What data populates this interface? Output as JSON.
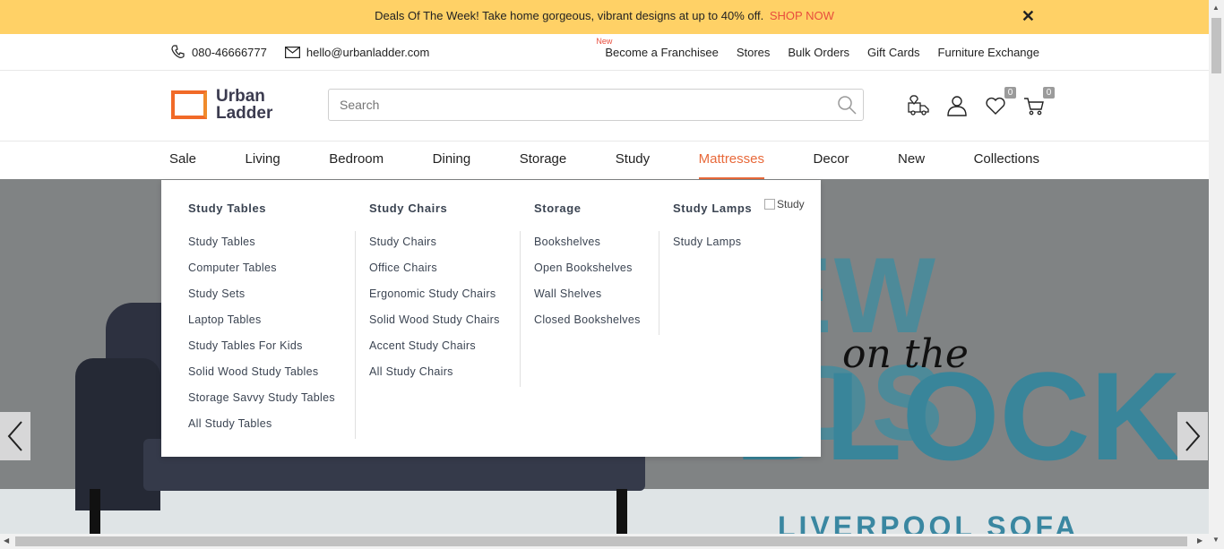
{
  "promo": {
    "text": "Deals Of The Week! Take home gorgeous, vibrant designs at up to 40% off.",
    "cta": "SHOP NOW",
    "close_icon": "close-icon"
  },
  "utility": {
    "phone": "080-46666777",
    "email": "hello@urbanladder.com",
    "new_tag": "New",
    "links": [
      "Become a Franchisee",
      "Stores",
      "Bulk Orders",
      "Gift Cards",
      "Furniture Exchange"
    ]
  },
  "header": {
    "logo_line1": "Urban",
    "logo_line2": "Ladder",
    "search_placeholder": "Search",
    "wishlist_count": "0",
    "cart_count": "0"
  },
  "nav": {
    "items": [
      "Sale",
      "Living",
      "Bedroom",
      "Dining",
      "Storage",
      "Study",
      "Mattresses",
      "Decor",
      "New",
      "Collections"
    ],
    "active": "Mattresses"
  },
  "mega_menu": {
    "columns": [
      {
        "heading": "Study Tables",
        "items": [
          "Study Tables",
          "Computer Tables",
          "Study Sets",
          "Laptop Tables",
          "Study Tables For Kids",
          "Solid Wood Study Tables",
          "Storage Savvy Study Tables",
          "All Study Tables"
        ]
      },
      {
        "heading": "Study Chairs",
        "items": [
          "Study Chairs",
          "Office Chairs",
          "Ergonomic Study Chairs",
          "Solid Wood Study Chairs",
          "Accent Study Chairs",
          "All Study Chairs"
        ]
      },
      {
        "heading": "Storage",
        "items": [
          "Bookshelves",
          "Open Bookshelves",
          "Wall Shelves",
          "Closed Bookshelves"
        ]
      },
      {
        "heading": "Study Lamps",
        "items": [
          "Study Lamps"
        ]
      }
    ],
    "image_alt": "Study"
  },
  "hero": {
    "line1": "NEW KIDS",
    "script": "on the",
    "line2": "BLOCK",
    "subtitle": "LIVERPOOL SOFA"
  },
  "colors": {
    "promo_bg": "#ffd166",
    "accent": "#e8693a",
    "cta": "#e84d3d"
  }
}
